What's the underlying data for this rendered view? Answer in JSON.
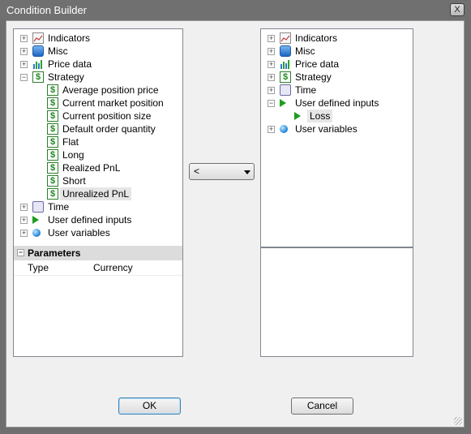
{
  "window": {
    "title": "Condition Builder",
    "close_glyph": "X"
  },
  "left_tree": {
    "items": [
      {
        "label": "Indicators",
        "icon": "chart-icon",
        "expander": "+"
      },
      {
        "label": "Misc",
        "icon": "database-icon",
        "expander": "+"
      },
      {
        "label": "Price data",
        "icon": "bar-chart-icon",
        "expander": "+"
      },
      {
        "label": "Strategy",
        "icon": "dollar-icon",
        "expander": "−"
      },
      {
        "label": "Average position price",
        "icon": "dollar-icon"
      },
      {
        "label": "Current market position",
        "icon": "dollar-icon"
      },
      {
        "label": "Current position size",
        "icon": "dollar-icon"
      },
      {
        "label": "Default order quantity",
        "icon": "dollar-icon"
      },
      {
        "label": "Flat",
        "icon": "dollar-icon"
      },
      {
        "label": "Long",
        "icon": "dollar-icon"
      },
      {
        "label": "Realized PnL",
        "icon": "dollar-icon"
      },
      {
        "label": "Short",
        "icon": "dollar-icon"
      },
      {
        "label": "Unrealized PnL",
        "icon": "dollar-icon"
      },
      {
        "label": "Time",
        "icon": "calendar-clock-icon",
        "expander": "+"
      },
      {
        "label": "User defined inputs",
        "icon": "play-icon",
        "expander": "+"
      },
      {
        "label": "User variables",
        "icon": "globe-icon",
        "expander": "+"
      }
    ]
  },
  "parameters": {
    "header": "Parameters",
    "collapse_glyph": "−",
    "row_name": "Type",
    "row_value": "Currency"
  },
  "combo": {
    "value": "<"
  },
  "right_tree": {
    "items": [
      {
        "label": "Indicators",
        "icon": "chart-icon",
        "expander": "+"
      },
      {
        "label": "Misc",
        "icon": "database-icon",
        "expander": "+"
      },
      {
        "label": "Price data",
        "icon": "bar-chart-icon",
        "expander": "+"
      },
      {
        "label": "Strategy",
        "icon": "dollar-icon",
        "expander": "+"
      },
      {
        "label": "Time",
        "icon": "calendar-clock-icon",
        "expander": "+"
      },
      {
        "label": "User defined inputs",
        "icon": "play-icon",
        "expander": "−"
      },
      {
        "label": "Loss",
        "icon": "play-icon"
      },
      {
        "label": "User variables",
        "icon": "globe-icon",
        "expander": "+"
      }
    ]
  },
  "buttons": {
    "ok": "OK",
    "cancel": "Cancel"
  }
}
